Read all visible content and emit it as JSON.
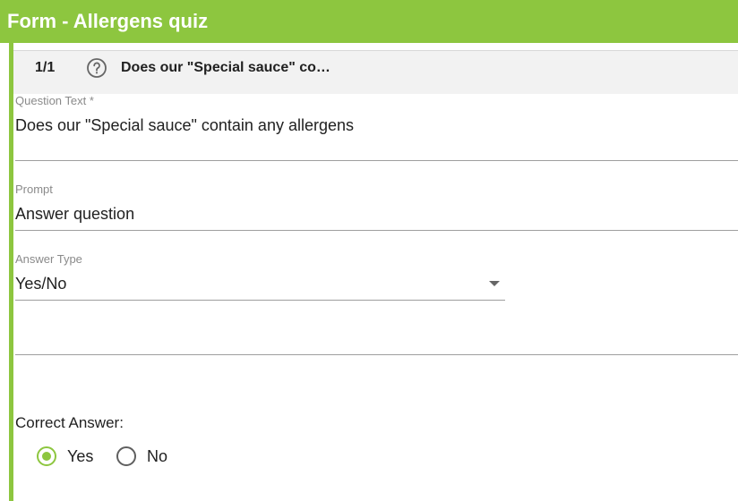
{
  "window": {
    "title": "Form - Allergens quiz"
  },
  "question_header": {
    "number": "1/1",
    "icon": "help-circle-icon",
    "summary": "Does our \"Special sauce\" co…"
  },
  "fields": {
    "question_text": {
      "label": "Question Text *",
      "value": "Does our \"Special sauce\" contain any allergens"
    },
    "prompt": {
      "label": "Prompt",
      "value": "Answer question"
    },
    "answer_type": {
      "label": "Answer Type",
      "value": "Yes/No"
    }
  },
  "correct_answer": {
    "label": "Correct Answer:",
    "options": [
      {
        "label": "Yes",
        "selected": true
      },
      {
        "label": "No",
        "selected": false
      }
    ]
  },
  "colors": {
    "accent": "#8dc63f",
    "header_bg": "#f2f2f2"
  }
}
